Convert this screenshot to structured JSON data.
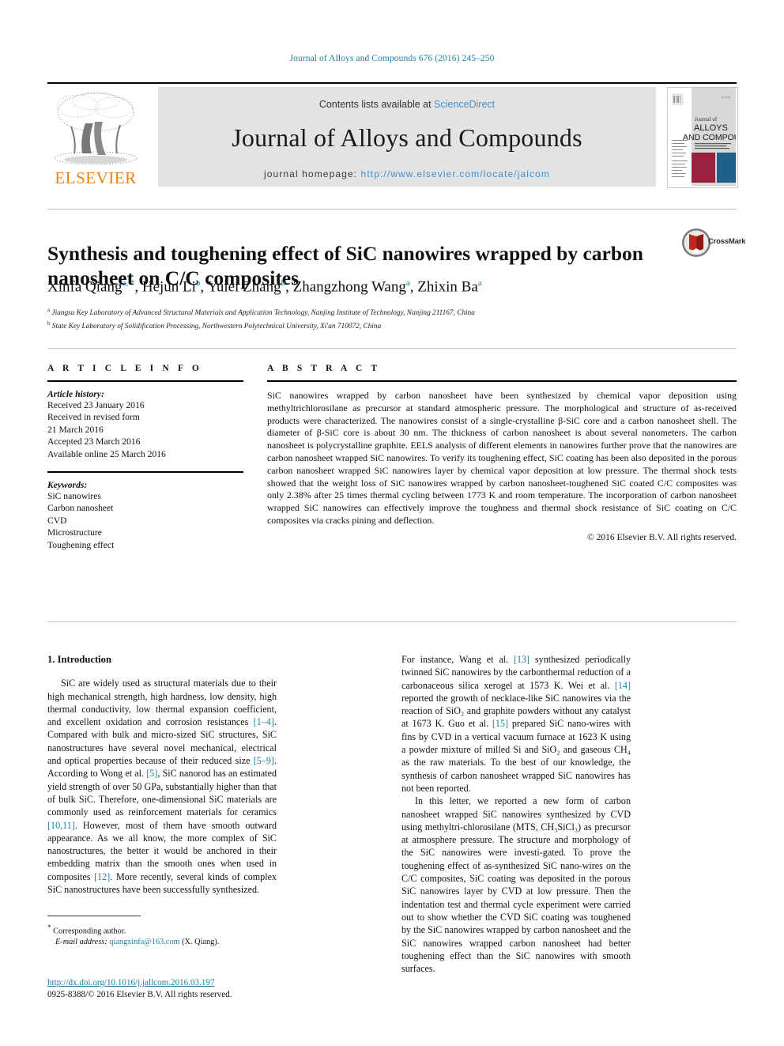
{
  "running_head": "Journal of Alloys and Compounds 676 (2016) 245–250",
  "masthead": {
    "contents_prefix": "Contents lists available at ",
    "sciencedirect": "ScienceDirect",
    "journal_name": "Journal of Alloys and Compounds",
    "homepage_label": "journal homepage: ",
    "homepage_url": "http://www.elsevier.com/locate/jalcom",
    "publisher": "ELSEVIER",
    "cover_title_line1": "Journal of",
    "cover_title_line2": "ALLOYS",
    "cover_title_line3": "AND COMPOUNDS",
    "accent_color": "#3f8fcf",
    "elsevier_orange": "#f07f13"
  },
  "article": {
    "title": "Synthesis and toughening effect of SiC nanowires wrapped by carbon nanosheet on C/C composites",
    "crossmark_label": "CrossMark",
    "authors": [
      {
        "name": "Xinfa Qiang",
        "marks": "a, *"
      },
      {
        "name": "Hejun Li",
        "marks": "b"
      },
      {
        "name": "Yulei Zhang",
        "marks": "b"
      },
      {
        "name": "Zhangzhong Wang",
        "marks": "a"
      },
      {
        "name": "Zhixin Ba",
        "marks": "a"
      }
    ],
    "affiliations": [
      {
        "mark": "a",
        "text": "Jiangsu Key Laboratory of Advanced Structural Materials and Application Technology, Nanjing Institute of Technology, Nanjing 211167, China"
      },
      {
        "mark": "b",
        "text": "State Key Laboratory of Solidification Processing, Northwestern Polytechnical University, Xi'an 710072, China"
      }
    ]
  },
  "article_info": {
    "heading": "A R T I C L E   I N F O",
    "history_label": "Article history:",
    "history": [
      "Received 23 January 2016",
      "Received in revised form",
      "21 March 2016",
      "Accepted 23 March 2016",
      "Available online 25 March 2016"
    ],
    "keywords_label": "Keywords:",
    "keywords": [
      "SiC nanowires",
      "Carbon nanosheet",
      "CVD",
      "Microstructure",
      "Toughening effect"
    ]
  },
  "abstract": {
    "heading": "A B S T R A C T",
    "text": "SiC nanowires wrapped by carbon nanosheet have been synthesized by chemical vapor deposition using methyltrichlorosilane as precursor at standard atmospheric pressure. The morphological and structure of as-received products were characterized. The nanowires consist of a single-crystalline β-SiC core and a carbon nanosheet shell. The diameter of β-SiC core is about 30 nm. The thickness of carbon nanosheet is about several nanometers. The carbon nanosheet is polycrystalline graphite. EELS analysis of different elements in nanowires further prove that the nanowires are carbon nanosheet wrapped SiC nanowires. To verify its toughening effect, SiC coating has been also deposited in the porous carbon nanosheet wrapped SiC nanowires layer by chemical vapor deposition at low pressure. The thermal shock tests showed that the weight loss of SiC nanowires wrapped by carbon nanosheet-toughened SiC coated C/C composites was only 2.38% after 25 times thermal cycling between 1773 K and room temperature. The incorporation of carbon nanosheet wrapped SiC nanowires can effectively improve the toughness and thermal shock resistance of SiC coating on C/C composites via cracks pining and deflection.",
    "copyright": "© 2016 Elsevier B.V. All rights reserved."
  },
  "body": {
    "section_number_title": "1.  Introduction",
    "left_paragraph_1_a": "SiC are widely used as structural materials due to their high mechanical strength, high hardness, low density, high thermal conductivity, low thermal expansion coefficient, and excellent oxidation and corrosion resistances ",
    "left_ref_1": "[1–4]",
    "left_paragraph_1_b": ". Compared with bulk and micro-sized SiC structures, SiC nanostructures have several novel mechanical, electrical and optical properties because of their reduced size ",
    "left_ref_2": "[5–9]",
    "left_paragraph_1_c": ". According to Wong et al. ",
    "left_ref_3": "[5]",
    "left_paragraph_1_d": ", SiC nanorod has an estimated yield strength of over 50 GPa, substantially higher than that of bulk SiC. Therefore, one-dimensional SiC materials are commonly used as reinforcement materials for ceramics ",
    "left_ref_4": "[10,11]",
    "left_paragraph_1_e": ". However, most of them have smooth outward appearance. As we all know, the more complex of SiC nanostructures, the better it would be anchored in their embedding matrix than the smooth ones when used in composites ",
    "left_ref_5": "[12]",
    "left_paragraph_1_f": ". More recently, several kinds of complex SiC nanostructures have been successfully synthesized.",
    "right_paragraph_1_a": "For instance, Wang et al. ",
    "right_ref_1": "[13]",
    "right_paragraph_1_b": " synthesized periodically twinned SiC nanowires by the carbonthermal reduction of a carbonaceous silica xerogel at 1573 K. Wei et al. ",
    "right_ref_2": "[14]",
    "right_paragraph_1_c": " reported the growth of necklace-like SiC nanowires via the reaction of SiO₂ and graphite powders without any catalyst at 1673 K. Guo et al. ",
    "right_ref_3": "[15]",
    "right_paragraph_1_d": " prepared SiC nano-wires with fins by CVD in a vertical vacuum furnace at 1623 K using a powder mixture of milled Si and SiO₂ and gaseous CH₄ as the raw materials. To the best of our knowledge, the synthesis of carbon nanosheet wrapped SiC nanowires has not been reported.",
    "right_paragraph_2": "In this letter, we reported a new form of carbon nanosheet wrapped SiC nanowires synthesized by CVD using methyltri-chlorosilane (MTS, CH₃SiCl₃) as precursor at atmosphere pressure. The structure and morphology of the SiC nanowires were investi-gated. To prove the toughening effect of as-synthesized SiC nano-wires on the C/C composites, SiC coating was deposited in the porous SiC nanowires layer by CVD at low pressure. Then the indentation test and thermal cycle experiment were carried out to show whether the CVD SiC coating was toughened by the SiC nanowires wrapped by carbon nanosheet and the SiC nanowires wrapped carbon nanosheet had better toughening effect than the SiC nanowires with smooth surfaces."
  },
  "footnotes": {
    "corresponding_author": "Corresponding author.",
    "email_label": "E-mail address: ",
    "email": "qiangxinfa@163.com",
    "email_suffix": " (X. Qiang).",
    "doi": "http://dx.doi.org/10.1016/j.jallcom.2016.03.197",
    "issn": "0925-8388/© 2016 Elsevier B.V. All rights reserved."
  }
}
